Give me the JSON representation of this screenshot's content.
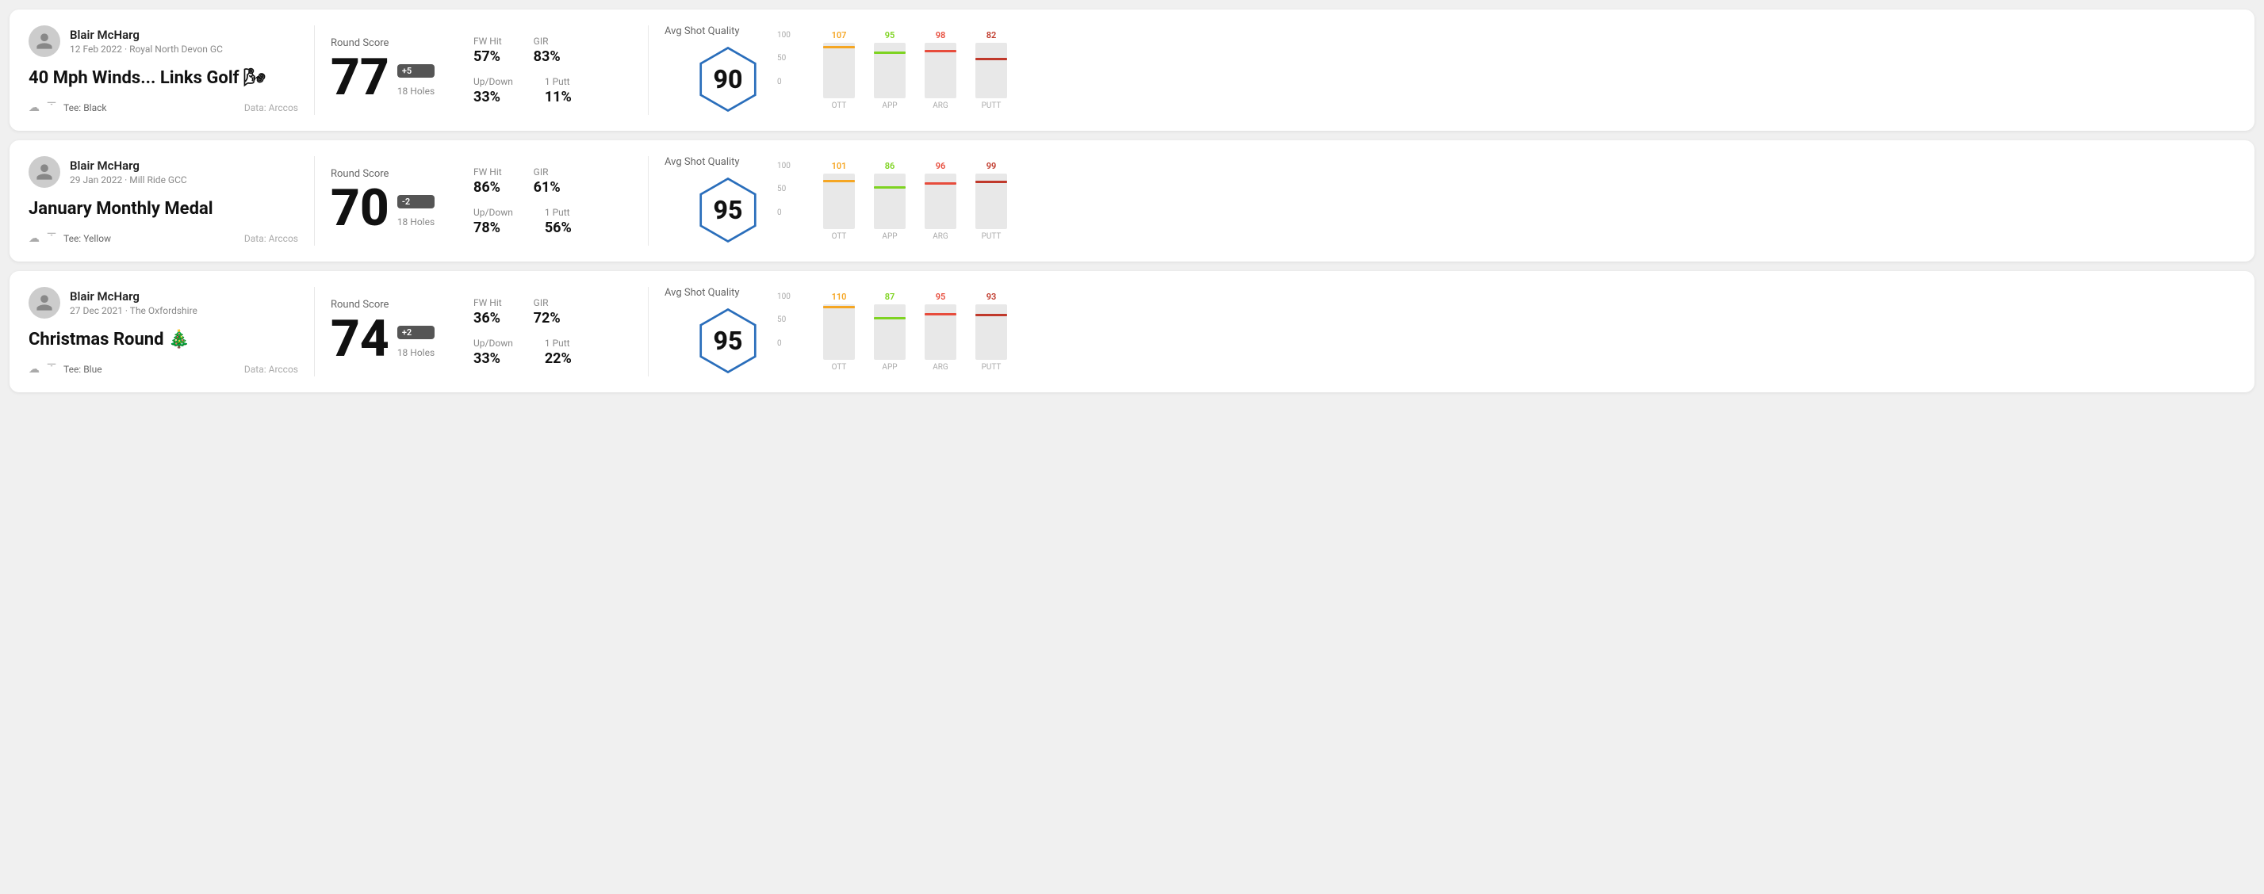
{
  "rounds": [
    {
      "id": "round1",
      "user": {
        "name": "Blair McHarg",
        "date_course": "12 Feb 2022 · Royal North Devon GC"
      },
      "title": "40 Mph Winds... Links Golf 🌬",
      "tee": "Black",
      "data_source": "Data: Arccos",
      "score": {
        "label": "Round Score",
        "number": "77",
        "badge": "+5",
        "badge_type": "positive",
        "holes": "18 Holes"
      },
      "stats": {
        "fw_hit_label": "FW Hit",
        "fw_hit_value": "57%",
        "gir_label": "GIR",
        "gir_value": "83%",
        "updown_label": "Up/Down",
        "updown_value": "33%",
        "one_putt_label": "1 Putt",
        "one_putt_value": "11%"
      },
      "quality": {
        "label": "Avg Shot Quality",
        "score": "90"
      },
      "chart": {
        "bars": [
          {
            "label": "OTT",
            "value": 107,
            "color": "#f5a623",
            "max": 100
          },
          {
            "label": "APP",
            "value": 95,
            "color": "#7ed321",
            "max": 100
          },
          {
            "label": "ARG",
            "value": 98,
            "color": "#e74c3c",
            "max": 100
          },
          {
            "label": "PUTT",
            "value": 82,
            "color": "#c0392b",
            "max": 100
          }
        ],
        "y_labels": [
          "100",
          "50",
          "0"
        ]
      }
    },
    {
      "id": "round2",
      "user": {
        "name": "Blair McHarg",
        "date_course": "29 Jan 2022 · Mill Ride GCC"
      },
      "title": "January Monthly Medal",
      "tee": "Yellow",
      "data_source": "Data: Arccos",
      "score": {
        "label": "Round Score",
        "number": "70",
        "badge": "-2",
        "badge_type": "negative",
        "holes": "18 Holes"
      },
      "stats": {
        "fw_hit_label": "FW Hit",
        "fw_hit_value": "86%",
        "gir_label": "GIR",
        "gir_value": "61%",
        "updown_label": "Up/Down",
        "updown_value": "78%",
        "one_putt_label": "1 Putt",
        "one_putt_value": "56%"
      },
      "quality": {
        "label": "Avg Shot Quality",
        "score": "95"
      },
      "chart": {
        "bars": [
          {
            "label": "OTT",
            "value": 101,
            "color": "#f5a623",
            "max": 100
          },
          {
            "label": "APP",
            "value": 86,
            "color": "#7ed321",
            "max": 100
          },
          {
            "label": "ARG",
            "value": 96,
            "color": "#e74c3c",
            "max": 100
          },
          {
            "label": "PUTT",
            "value": 99,
            "color": "#c0392b",
            "max": 100
          }
        ],
        "y_labels": [
          "100",
          "50",
          "0"
        ]
      }
    },
    {
      "id": "round3",
      "user": {
        "name": "Blair McHarg",
        "date_course": "27 Dec 2021 · The Oxfordshire"
      },
      "title": "Christmas Round 🎄",
      "tee": "Blue",
      "data_source": "Data: Arccos",
      "score": {
        "label": "Round Score",
        "number": "74",
        "badge": "+2",
        "badge_type": "positive",
        "holes": "18 Holes"
      },
      "stats": {
        "fw_hit_label": "FW Hit",
        "fw_hit_value": "36%",
        "gir_label": "GIR",
        "gir_value": "72%",
        "updown_label": "Up/Down",
        "updown_value": "33%",
        "one_putt_label": "1 Putt",
        "one_putt_value": "22%"
      },
      "quality": {
        "label": "Avg Shot Quality",
        "score": "95"
      },
      "chart": {
        "bars": [
          {
            "label": "OTT",
            "value": 110,
            "color": "#f5a623",
            "max": 100
          },
          {
            "label": "APP",
            "value": 87,
            "color": "#7ed321",
            "max": 100
          },
          {
            "label": "ARG",
            "value": 95,
            "color": "#e74c3c",
            "max": 100
          },
          {
            "label": "PUTT",
            "value": 93,
            "color": "#c0392b",
            "max": 100
          }
        ],
        "y_labels": [
          "100",
          "50",
          "0"
        ]
      }
    }
  ],
  "icons": {
    "avatar": "person-icon",
    "weather": "☁",
    "tee": "⛳"
  }
}
